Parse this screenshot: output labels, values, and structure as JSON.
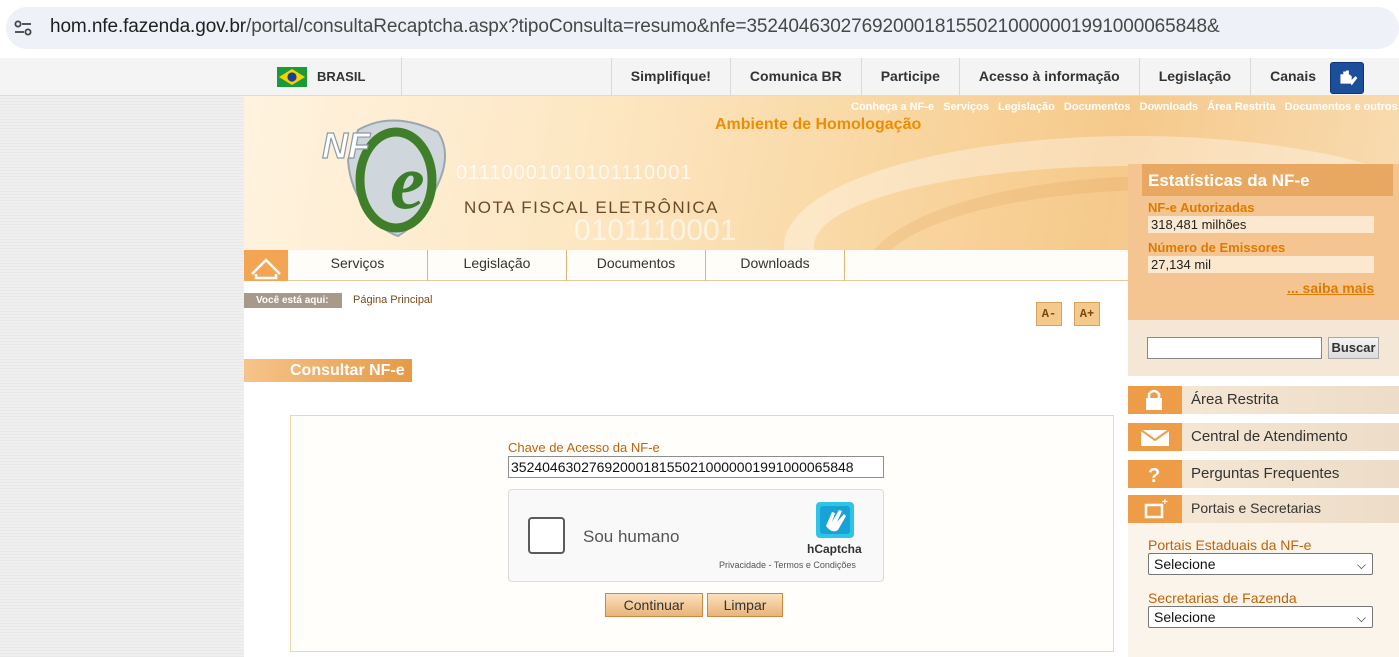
{
  "browser": {
    "url_domain": "hom.nfe.fazenda.gov.br",
    "url_path": "/portal/consultaRecaptcha.aspx?tipoConsulta=resumo&nfe=35240463027692000181550210000001991000065848&"
  },
  "govbar": {
    "country": "BRASIL",
    "links": [
      "Simplifique!",
      "Comunica BR",
      "Participe",
      "Acesso à informação",
      "Legislação",
      "Canais"
    ]
  },
  "banner": {
    "ambiente": "Ambiente de Homologação",
    "title": "NOTA FISCAL ELETRÔNICA",
    "binary1": "01110001010101110001",
    "binary2": "0101110001",
    "top_links": [
      "Conheça a NF-e",
      "Serviços",
      "Legislação",
      "Documentos",
      "Downloads",
      "Área Restrita",
      "Documentos e outros"
    ]
  },
  "stats": {
    "title": "Estatísticas da NF-e",
    "autorizadas_label": "NF-e Autorizadas",
    "autorizadas_value": "318,481 milhões",
    "emissores_label": "Número de Emissores",
    "emissores_value": "27,134 mil",
    "more_link": "... saiba mais"
  },
  "nav": {
    "items": [
      "Serviços",
      "Legislação",
      "Documentos",
      "Downloads"
    ]
  },
  "breadcrumb": {
    "label": "Você está aqui:",
    "page": "Página Principal"
  },
  "font_controls": {
    "decrease": "A-",
    "increase": "A+"
  },
  "consulta": {
    "heading": "Consultar NF-e",
    "chave_label": "Chave de Acesso da NF-e",
    "chave_value": "35240463027692000181550210000001991000065848",
    "captcha_text": "Sou humano",
    "captcha_brand": "hCaptcha",
    "captcha_links": "Privacidade - Termos e Condições",
    "continuar": "Continuar",
    "limpar": "Limpar"
  },
  "search": {
    "button": "Buscar",
    "value": ""
  },
  "sidebar": {
    "items": [
      "Área Restrita",
      "Central de Atendimento",
      "Perguntas Frequentes",
      "Portais e Secretarias"
    ],
    "portais_label": "Portais Estaduais da NF-e",
    "portais_selected": "Selecione",
    "secretarias_label": "Secretarias de Fazenda",
    "secretarias_selected": "Selecione"
  }
}
